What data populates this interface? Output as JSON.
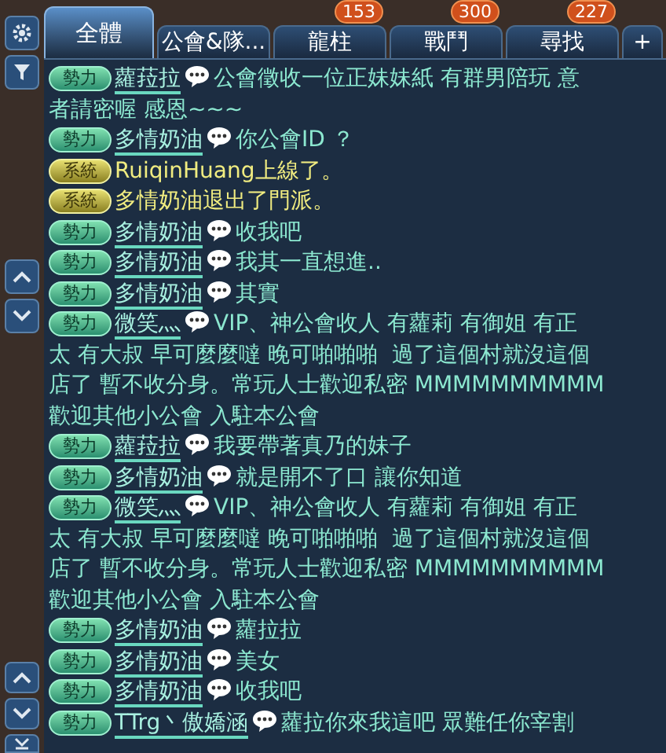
{
  "tabs": [
    {
      "label": "全體",
      "selected": true
    },
    {
      "label": "公會&隊...",
      "selected": false
    },
    {
      "label": "龍柱",
      "selected": false,
      "badge": "153"
    },
    {
      "label": "戰鬥",
      "selected": false,
      "badge": "300"
    },
    {
      "label": "尋找",
      "selected": false,
      "badge": "227"
    },
    {
      "label": "+",
      "selected": false
    }
  ],
  "messages": [
    {
      "kind": "faction",
      "badge": "勢力",
      "sender": "蘿菈拉",
      "text": "公會徵收一位正妹妹紙 有群男陪玩 意",
      "more_lines": [
        "者請密喔 感恩~~~"
      ]
    },
    {
      "kind": "faction",
      "badge": "勢力",
      "sender": "多情奶油",
      "text": "你公會ID ？"
    },
    {
      "kind": "system",
      "badge": "系統",
      "text": "RuiqinHuang上線了。"
    },
    {
      "kind": "system",
      "badge": "系統",
      "text": "多情奶油退出了門派。"
    },
    {
      "kind": "faction",
      "badge": "勢力",
      "sender": "多情奶油",
      "text": "收我吧"
    },
    {
      "kind": "faction",
      "badge": "勢力",
      "sender": "多情奶油",
      "text": "我其一直想進.."
    },
    {
      "kind": "faction",
      "badge": "勢力",
      "sender": "多情奶油",
      "text": "其實"
    },
    {
      "kind": "faction",
      "badge": "勢力",
      "sender": "微笑灬",
      "text": "VIP、神公會收人 有蘿莉 有御姐 有正",
      "more_lines": [
        "太 有大叔 早可麼麼噠 晚可啪啪啪  過了這個村就沒這個",
        "店了 暫不收分身。常玩人士歡迎私密 MMMMMMMMMM",
        "歡迎其他小公會 入駐本公會"
      ]
    },
    {
      "kind": "faction",
      "badge": "勢力",
      "sender": "蘿菈拉",
      "text": "我要帶著真乃的妹子"
    },
    {
      "kind": "faction",
      "badge": "勢力",
      "sender": "多情奶油",
      "text": "就是開不了口 讓你知道"
    },
    {
      "kind": "faction",
      "badge": "勢力",
      "sender": "微笑灬",
      "text": "VIP、神公會收人 有蘿莉 有御姐 有正",
      "more_lines": [
        "太 有大叔 早可麼麼噠 晚可啪啪啪  過了這個村就沒這個",
        "店了 暫不收分身。常玩人士歡迎私密 MMMMMMMMMM",
        "歡迎其他小公會 入駐本公會"
      ]
    },
    {
      "kind": "faction",
      "badge": "勢力",
      "sender": "多情奶油",
      "text": "蘿拉拉"
    },
    {
      "kind": "faction",
      "badge": "勢力",
      "sender": "多情奶油",
      "text": "美女"
    },
    {
      "kind": "faction",
      "badge": "勢力",
      "sender": "多情奶油",
      "text": "收我吧"
    },
    {
      "kind": "faction",
      "badge": "勢力",
      "sender": "TTrg丶傲嬌涵",
      "text": "蘿拉你來我這吧 眾難任你宰割"
    }
  ]
}
